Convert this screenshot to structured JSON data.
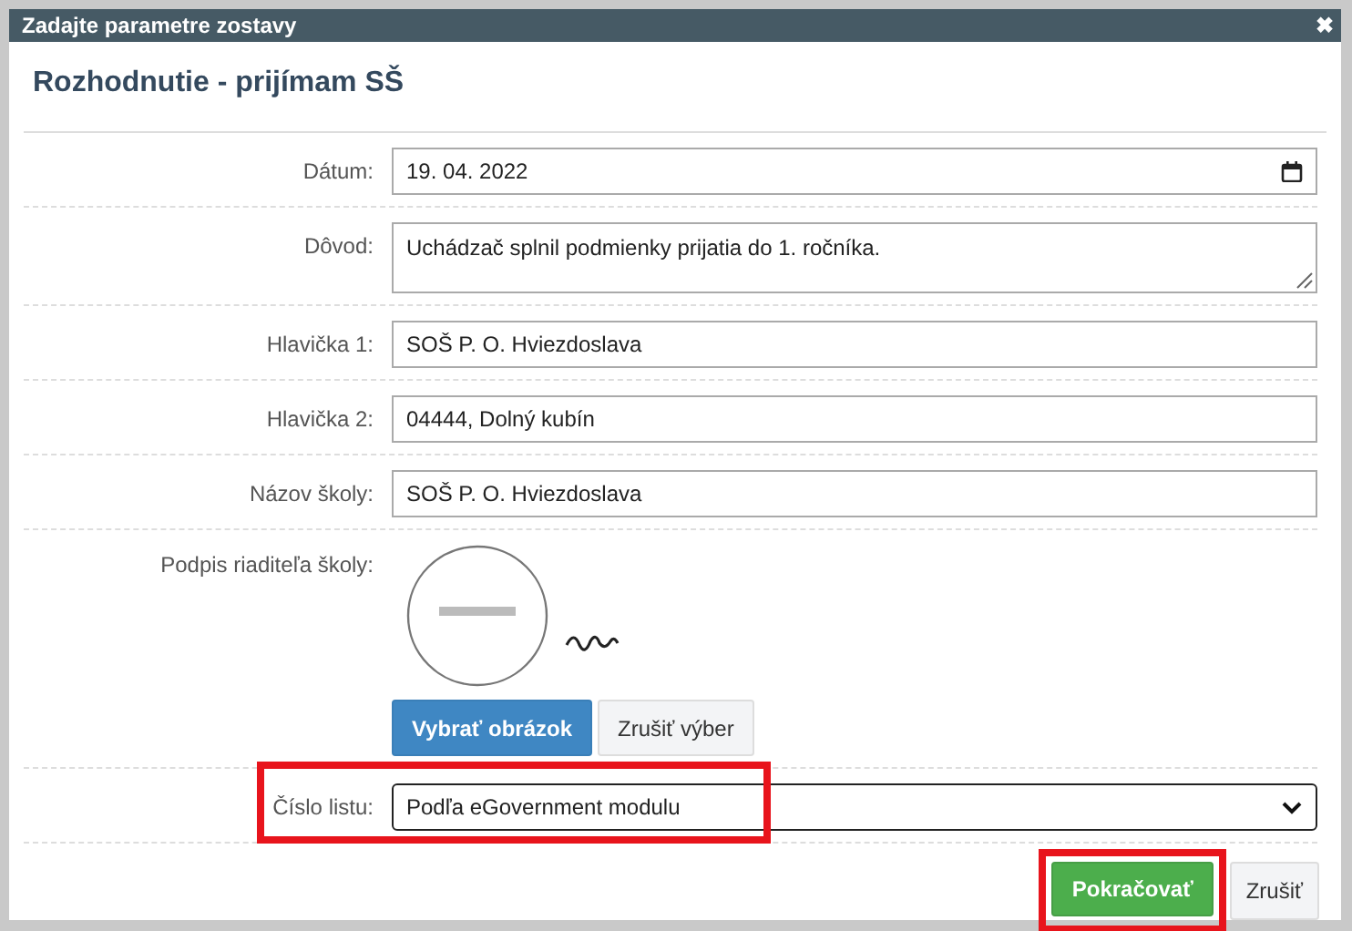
{
  "window": {
    "title": "Zadajte parametre zostavy",
    "close": "✖"
  },
  "heading": "Rozhodnutie - prijímam SŠ",
  "fields": [
    {
      "kind": "date",
      "label": "Dátum:",
      "value": "19. 04. 2022",
      "highlighted": false
    },
    {
      "kind": "textarea",
      "label": "Dôvod:",
      "value": "Uchádzač splnil podmienky prijatia do 1. ročníka.",
      "highlighted": false
    },
    {
      "kind": "text",
      "label": "Hlavička 1:",
      "value": "SOŠ P. O. Hviezdoslava",
      "highlighted": false
    },
    {
      "kind": "text",
      "label": "Hlavička 2:",
      "value": "04444, Dolný kubín",
      "highlighted": false
    },
    {
      "kind": "text",
      "label": "Názov školy:",
      "value": "SOŠ P. O. Hviezdoslava",
      "highlighted": false
    },
    {
      "label": "Podpis riaditeľa školy:",
      "buttons": [
        {
          "label": "Vybrať obrázok",
          "primary": true
        },
        {
          "label": "Zrušiť výber",
          "primary": false
        }
      ],
      "highlighted": false
    },
    {
      "kind": "select",
      "label": "Číslo listu:",
      "value": "Podľa eGovernment modulu",
      "highlighted": true
    }
  ],
  "buttons": [
    {
      "label": "Pokračovať",
      "primary": true,
      "highlighted": true
    },
    {
      "label": "Zrušiť",
      "primary": false,
      "highlighted": false
    }
  ]
}
